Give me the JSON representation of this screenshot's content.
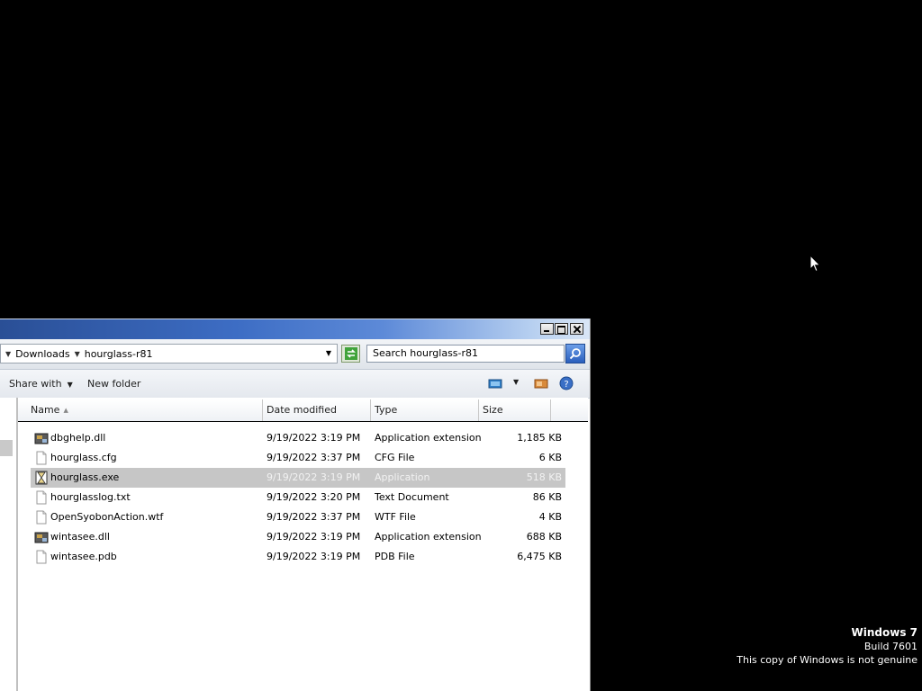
{
  "window": {
    "address": {
      "crumbs": [
        "Downloads",
        "hourglass-r81"
      ]
    },
    "search": {
      "placeholder": "Search hourglass-r81"
    },
    "toolbar": {
      "share_with": "Share with",
      "new_folder": "New folder"
    },
    "columns": {
      "name": "Name",
      "date": "Date modified",
      "type": "Type",
      "size": "Size"
    },
    "files": [
      {
        "name": "dbghelp.dll",
        "date": "9/19/2022 3:19 PM",
        "type": "Application extension",
        "size": "1,185 KB",
        "icon": "dll-icon"
      },
      {
        "name": "hourglass.cfg",
        "date": "9/19/2022 3:37 PM",
        "type": "CFG File",
        "size": "6 KB",
        "icon": "file-icon"
      },
      {
        "name": "hourglass.exe",
        "date": "9/19/2022 3:19 PM",
        "type": "Application",
        "size": "518 KB",
        "icon": "hourglass-icon",
        "selected": true
      },
      {
        "name": "hourglasslog.txt",
        "date": "9/19/2022 3:20 PM",
        "type": "Text Document",
        "size": "86 KB",
        "icon": "file-icon"
      },
      {
        "name": "OpenSyobonAction.wtf",
        "date": "9/19/2022 3:37 PM",
        "type": "WTF File",
        "size": "4 KB",
        "icon": "file-icon"
      },
      {
        "name": "wintasee.dll",
        "date": "9/19/2022 3:19 PM",
        "type": "Application extension",
        "size": "688 KB",
        "icon": "dll-icon"
      },
      {
        "name": "wintasee.pdb",
        "date": "9/19/2022 3:19 PM",
        "type": "PDB File",
        "size": "6,475 KB",
        "icon": "file-icon"
      }
    ]
  },
  "desktop": {
    "watermark": {
      "line1": "Windows 7",
      "line2": "Build 7601",
      "line3": "This copy of Windows is not genuine"
    }
  },
  "colors": {
    "desktop_bg": "#000000",
    "titlebar": "#3d6dc4",
    "selection": "#c6c6c6"
  }
}
